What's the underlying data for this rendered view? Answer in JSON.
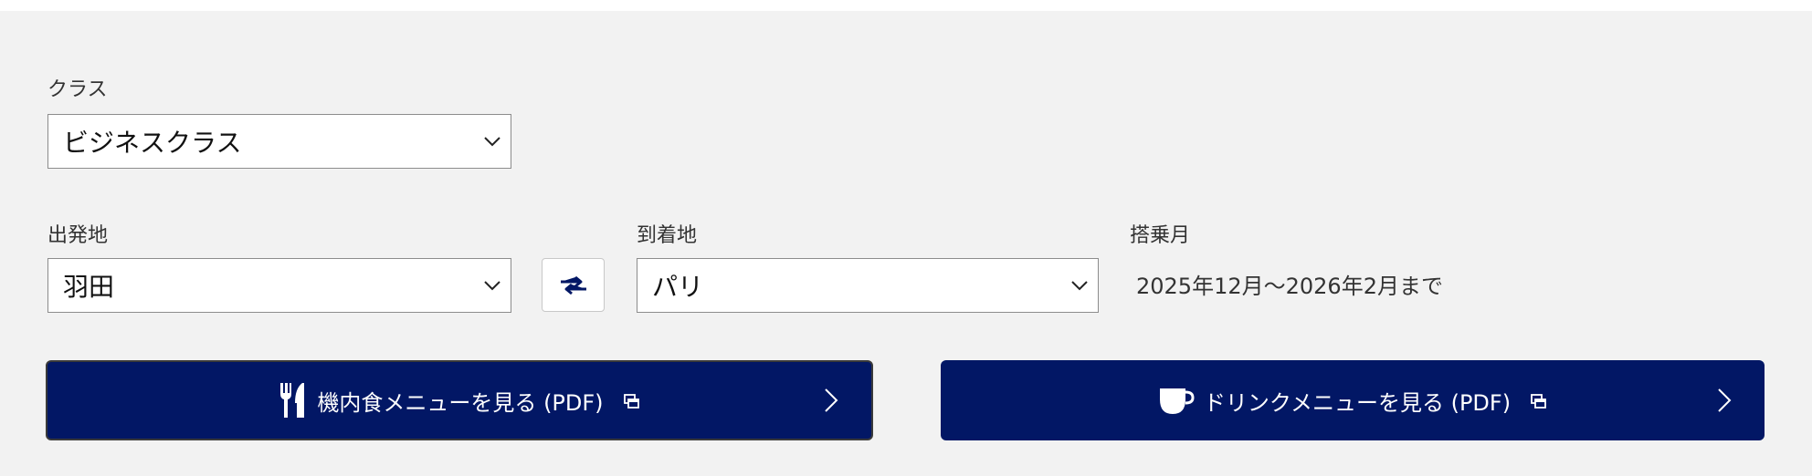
{
  "class_field": {
    "label": "クラス",
    "value": "ビジネスクラス"
  },
  "departure": {
    "label": "出発地",
    "value": "羽田"
  },
  "swap_button": {
    "icon": "swap-arrows-icon"
  },
  "arrival": {
    "label": "到着地",
    "value": "パリ"
  },
  "boarding_month": {
    "label": "搭乗月",
    "value": "2025年12月〜2026年2月まで"
  },
  "buttons": {
    "meal": {
      "label": "機内食メニューを見る (PDF)",
      "icon": "fork-knife-icon"
    },
    "drink": {
      "label": "ドリンクメニューを見る (PDF)",
      "icon": "coffee-cup-icon"
    }
  },
  "colors": {
    "button_bg": "#021765",
    "panel_bg": "#f2f2f2"
  }
}
